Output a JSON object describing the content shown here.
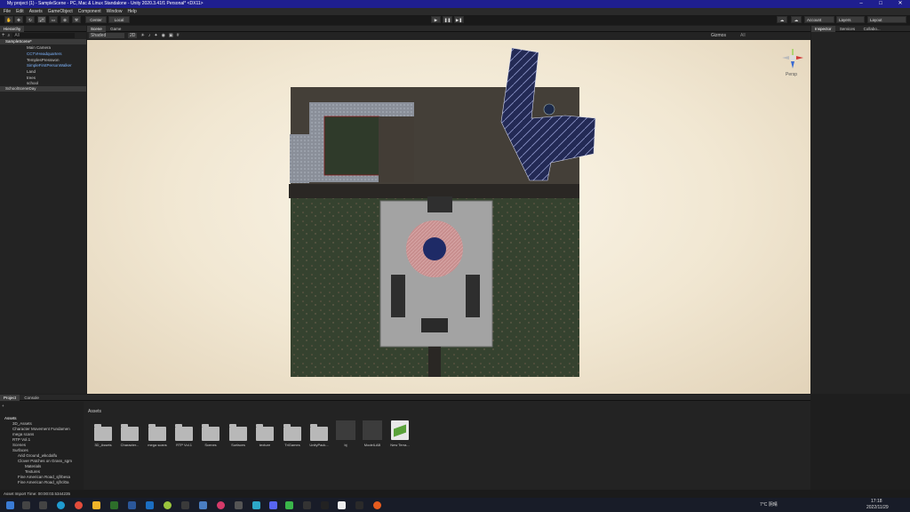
{
  "window": {
    "title": "My project (1) - SampleScene - PC, Mac & Linux Standalone - Unity 2020.3.41f1 Personal* <DX11>",
    "controls": [
      "–",
      "□",
      "✕"
    ]
  },
  "menu": [
    "File",
    "Edit",
    "Assets",
    "GameObject",
    "Component",
    "Window",
    "Help"
  ],
  "toolbar": {
    "pivot": "Center",
    "space": "Local",
    "account": "Account",
    "layers": "Layers",
    "layout": "Layout"
  },
  "hierarchy": {
    "tab": "Hierarchy",
    "search_placeholder": "All",
    "items": [
      {
        "label": "SampleScene*",
        "type": "scene"
      },
      {
        "label": "Main Camera",
        "type": "object"
      },
      {
        "label": "CCTVHeadquarters",
        "type": "prefab"
      },
      {
        "label": "TemplesPresswon",
        "type": "object"
      },
      {
        "label": "SimpleFirstPersonWalker",
        "type": "prefab"
      },
      {
        "label": "Land",
        "type": "object"
      },
      {
        "label": "trees",
        "type": "object"
      },
      {
        "label": "school",
        "type": "object"
      },
      {
        "label": "SchoolSceneDay",
        "type": "scene"
      }
    ]
  },
  "scene_view": {
    "tabs": [
      "Scene",
      "Game"
    ],
    "shading": "Shaded",
    "mode": "2D",
    "gizmos": "Gizmos",
    "search": "All",
    "gizmo_label": "Persp"
  },
  "inspector": {
    "tabs": [
      "Inspector",
      "Services",
      "Collabo..."
    ]
  },
  "project": {
    "tabs": [
      "Project",
      "Console"
    ],
    "breadcrumb": "Assets",
    "tree": [
      {
        "label": "Assets",
        "level": 0
      },
      {
        "label": "3D_Assets",
        "level": 1
      },
      {
        "label": "Character Movement Fundamen",
        "level": 1
      },
      {
        "label": "mega scans",
        "level": 1
      },
      {
        "label": "RTP Vol.1",
        "level": 1
      },
      {
        "label": "Scenes",
        "level": 1
      },
      {
        "label": "Surfaces",
        "level": 1
      },
      {
        "label": "Arid Ground_wkcdalfu",
        "level": 2
      },
      {
        "label": "Clover Patches on Grass_sgm",
        "level": 2
      },
      {
        "label": "Materials",
        "level": 3
      },
      {
        "label": "Textures",
        "level": 3
      },
      {
        "label": "Fine American Road_sjfrbesa",
        "level": 2
      },
      {
        "label": "Fine American Road_sjfrcl0a",
        "level": 2
      }
    ],
    "assets": [
      {
        "label": "3D_Assets",
        "kind": "folder"
      },
      {
        "label": "Character...",
        "kind": "folder"
      },
      {
        "label": "mega scans",
        "kind": "folder"
      },
      {
        "label": "RTP Vol.1",
        "kind": "folder"
      },
      {
        "label": "Scenes",
        "kind": "folder"
      },
      {
        "label": "Surfaces",
        "kind": "folder"
      },
      {
        "label": "texture",
        "kind": "folder"
      },
      {
        "label": "TriGames",
        "kind": "folder"
      },
      {
        "label": "UnityPack...",
        "kind": "folder"
      },
      {
        "label": "bj",
        "kind": "model"
      },
      {
        "label": "ModelLAB",
        "kind": "model"
      },
      {
        "label": "New Terra...",
        "kind": "terrain"
      }
    ]
  },
  "status": {
    "text": "Asset Import Time: 00:00:03.5344235"
  },
  "taskbar": {
    "weather": "7°C 阴晴",
    "time": "17:18",
    "date": "2022/11/29"
  },
  "colors": {
    "accent": "#1f1f8f",
    "editor_bg": "#1e1e1e",
    "panel_bg": "#282828",
    "grass": "#3a4a33",
    "roof": "#4d4a44"
  }
}
